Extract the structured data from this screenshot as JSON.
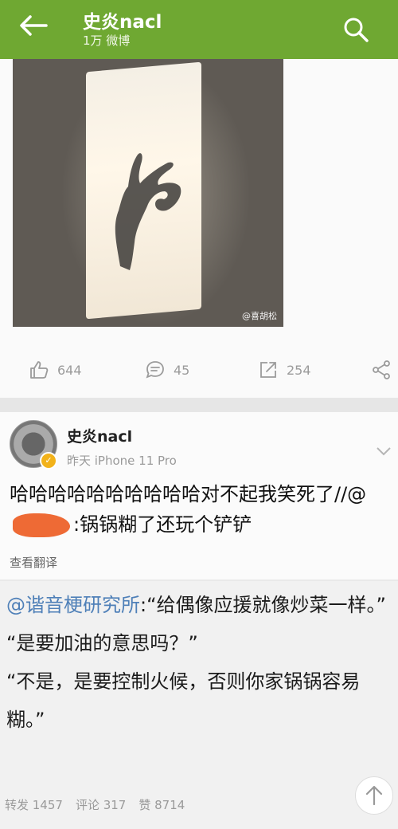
{
  "header": {
    "title": "史炎nacl",
    "subtitle": "1万 微博"
  },
  "post": {
    "watermark": "@喜胡松",
    "actions": {
      "like_count": "644",
      "comment_count": "45",
      "repost_count": "254"
    }
  },
  "repost": {
    "author": "史炎nacl",
    "meta": "昨天  iPhone 11 Pro",
    "text_before": "哈哈哈哈哈哈哈哈哈哈对不起我笑死了//@",
    "text_after": ":锅锅糊了还玩个铲铲",
    "translate_label": "查看翻译"
  },
  "original": {
    "mention": "@谐音梗研究所",
    "line1": ":“给偶像应援就像炒菜一样。”",
    "line2": "“是要加油的意思吗？”",
    "line3": "“不是，是要控制火候，否则你家锅锅容易糊。”",
    "stats": {
      "repost": "转发 1457",
      "comment": "评论 317",
      "like": "赞 8714"
    }
  },
  "colors": {
    "topbar": "#6fa832",
    "mention": "#4f80b8",
    "redaction": "#ee6a35"
  }
}
